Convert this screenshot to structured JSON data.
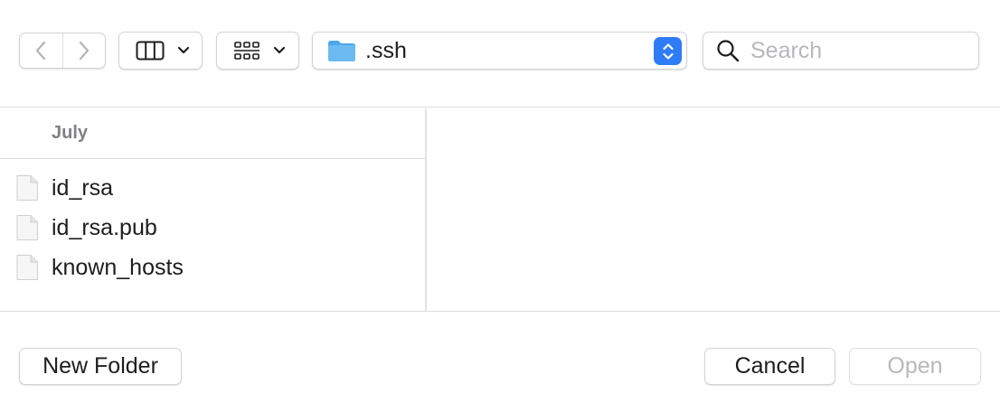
{
  "toolbar": {
    "back_icon": "chevron-left-icon",
    "forward_icon": "chevron-right-icon",
    "view_mode_icon": "columns-view-icon",
    "group_mode_icon": "grid-view-icon",
    "dropdown_icon": "chevron-down-icon",
    "location": ".ssh",
    "location_icon": "folder-icon",
    "search_placeholder": "Search"
  },
  "browser": {
    "group_label": "July",
    "files": [
      {
        "name": "id_rsa",
        "icon": "document-icon"
      },
      {
        "name": "id_rsa.pub",
        "icon": "document-icon"
      },
      {
        "name": "known_hosts",
        "icon": "document-icon"
      }
    ]
  },
  "footer": {
    "new_folder_label": "New Folder",
    "cancel_label": "Cancel",
    "open_label": "Open"
  },
  "colors": {
    "accent": "#2e7cf6",
    "folder": "#5fb1ee",
    "disabled_text": "#b8b8bc",
    "group_label": "#808085"
  }
}
